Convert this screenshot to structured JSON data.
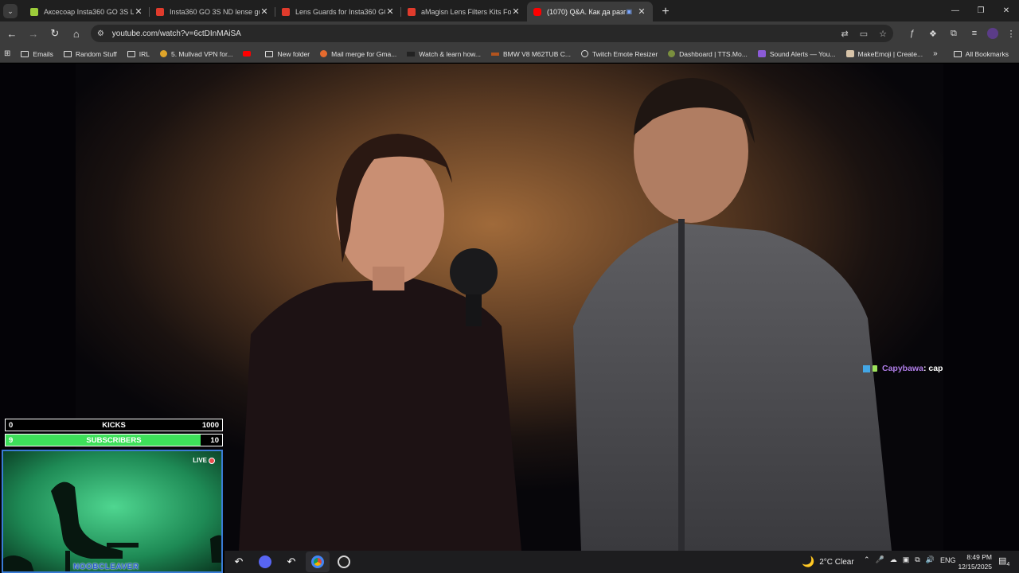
{
  "tabs": [
    {
      "title": "Аксесоар Insta360 GO 3S Lens",
      "favicon_color": "#9ccc3a"
    },
    {
      "title": "Insta360 GO 3S ND lense guard",
      "favicon_color": "#e03b2c"
    },
    {
      "title": "Lens Guards for Insta360 GO 3S",
      "favicon_color": "#e03b2c"
    },
    {
      "title": "aMagisn Lens Filters Kits For 36",
      "favicon_color": "#e03b2c"
    },
    {
      "title": "(1070) Q&A. Как да разпоз",
      "favicon_color": "#ff0000",
      "active": true
    }
  ],
  "address": {
    "url": "youtube.com/watch?v=6ctDInMAiSA"
  },
  "bookmarks": [
    {
      "label": "Emails",
      "icon": "folder-icon"
    },
    {
      "label": "Random Stuff",
      "icon": "folder-icon"
    },
    {
      "label": "IRL",
      "icon": "folder-icon"
    },
    {
      "label": "5. Mullvad VPN for...",
      "icon": "mullvad-icon"
    },
    {
      "label": "",
      "icon": "youtube-icon"
    },
    {
      "label": "New folder",
      "icon": "folder-icon"
    },
    {
      "label": "Mail merge for Gma...",
      "icon": "mailmerge-icon"
    },
    {
      "label": "Watch & learn how...",
      "icon": "watch-icon"
    },
    {
      "label": "BMW V8 M62TUB C...",
      "icon": "bmw-icon"
    },
    {
      "label": "Twitch Emote Resizer",
      "icon": "globe-icon"
    },
    {
      "label": "Dashboard | TTS.Mo...",
      "icon": "tts-icon"
    },
    {
      "label": "Sound Alerts — You...",
      "icon": "soundalerts-icon"
    },
    {
      "label": "MakeEmoji | Create...",
      "icon": "makeemoji-icon"
    }
  ],
  "all_bookmarks": "All Bookmarks",
  "chat": {
    "user": "Capybawa",
    "message": " : cap"
  },
  "kicks_bar": {
    "left": "0",
    "label": "KICKS",
    "right": "1000",
    "progress": 0.0
  },
  "subs_bar": {
    "left": "9",
    "label": "SUBSCRIBERS",
    "right": "10",
    "progress": 0.9
  },
  "cam": {
    "live": "LIVE",
    "name": "NOOBCLEAVER"
  },
  "taskbar": {
    "weather": "2°C  Clear",
    "lang": "ENG",
    "time": "8:49 PM",
    "date": "12/15/2025",
    "notifications": "4"
  },
  "colors": {
    "accent_green": "#3ee05a",
    "chat_user": "#b07de8",
    "cam_border": "#3a7bd5"
  }
}
